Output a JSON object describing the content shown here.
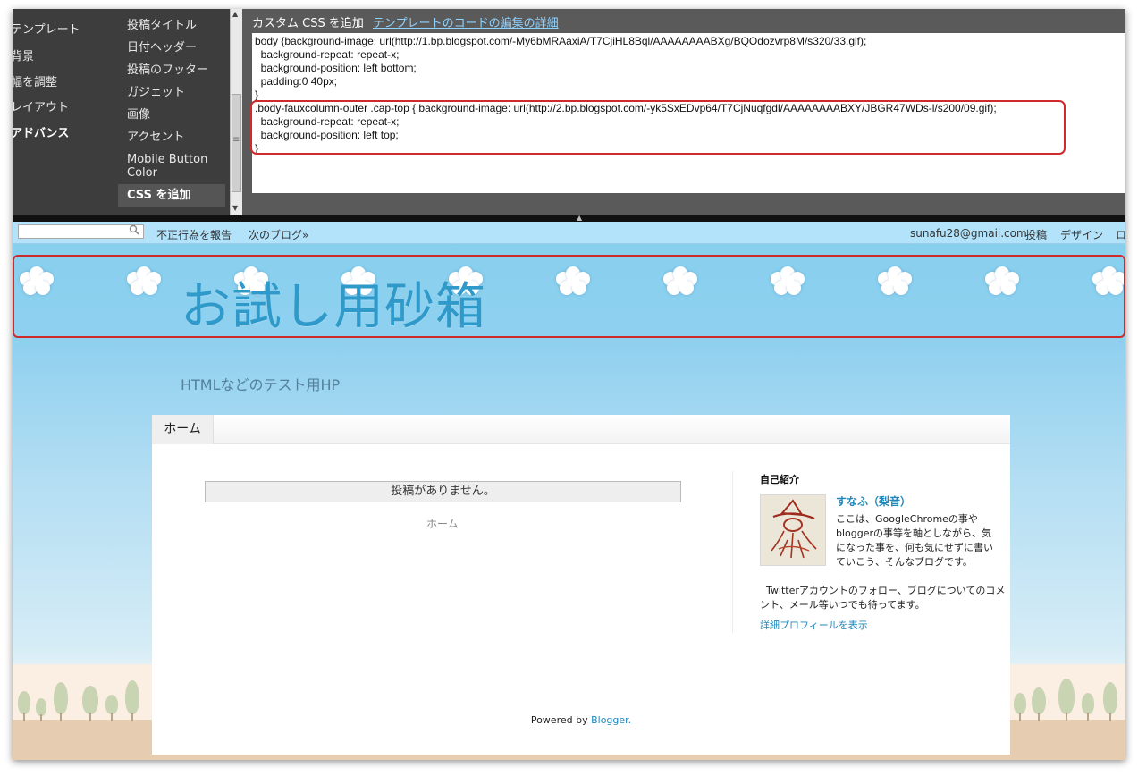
{
  "designer": {
    "main_nav": [
      "テンプレート",
      "背景",
      "幅を調整",
      "レイアウト",
      "アドバンス"
    ],
    "sub_nav": [
      "投稿タイトル",
      "日付ヘッダー",
      "投稿のフッター",
      "ガジェット",
      "画像",
      "アクセント",
      "Mobile Button Color",
      "CSS を追加"
    ],
    "css_panel": {
      "title": "カスタム CSS を追加",
      "link": "テンプレートのコードの編集の詳細",
      "code_lines": [
        "body {background-image: url(http://1.bp.blogspot.com/-My6bMRAaxiA/T7CjiHL8Bql/AAAAAAAABXg/BQOdozvrp8M/s320/33.gif);",
        "  background-repeat: repeat-x;",
        "  background-position: left bottom;",
        "  padding:0 40px;",
        "}",
        ".body-fauxcolumn-outer .cap-top { background-image: url(http://2.bp.blogspot.com/-yk5SxEDvp64/T7CjNuqfgdl/AAAAAAAABXY/JBGR47WDs-l/s200/09.gif);",
        "  background-repeat: repeat-x;",
        "  background-position: left top;",
        "}"
      ]
    }
  },
  "navbar": {
    "report": "不正行為を報告",
    "next_blog": "次のブログ»",
    "email": "sunafu28@gmail.com",
    "post": "投稿",
    "design": "デザイン",
    "cut": "ロ"
  },
  "blog": {
    "title": "お試し用砂箱",
    "description": "HTMLなどのテスト用HP",
    "tab_home": "ホーム",
    "no_posts": "投稿がありません。",
    "home_link": "ホーム"
  },
  "profile": {
    "heading": "自己紹介",
    "name": "すなふ（梨音）",
    "desc1": "ここは、GoogleChromeの事やbloggerの事等を軸としながら、気になった事を、何も気にせずに書いていこう、そんなブログです。",
    "desc2": "Twitterアカウントのフォロー、ブログについてのコメント、メール等いつでも待ってます。",
    "link": "詳細プロフィールを表示"
  },
  "footer": {
    "powered_by": "Powered by",
    "blogger": "Blogger."
  },
  "colors": {
    "title": "#2f9ac9",
    "link": "#2288bb",
    "highlight_border": "#d12a2a"
  }
}
